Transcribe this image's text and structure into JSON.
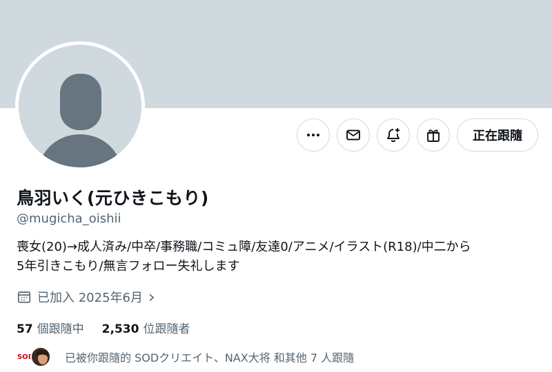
{
  "profile": {
    "display_name": "鳥羽いく(元ひきこもり)",
    "handle": "@mugicha_oishii",
    "bio_line1": "喪女(20)→成人済み/中卒/事務職/コミュ障/友達0/アニメ/イラスト(R18)/中二から",
    "bio_line2": "5年引きこもり/無言フォロー失礼します",
    "joined": "已加入 2025年6月",
    "joined_chevron": "›"
  },
  "actions": {
    "more_icon": "more-icon",
    "message_icon": "mail-icon",
    "notify_icon": "bell-plus-icon",
    "gift_icon": "gift-icon",
    "follow_label": "正在跟隨"
  },
  "stats": {
    "following_count": "57",
    "following_label": "個跟隨中",
    "followers_count": "2,530",
    "followers_label": "位跟隨者"
  },
  "followed_by": {
    "avatar1_text": "SOD",
    "text": "已被你跟隨的 SODクリエイト、NAX大将 和其他 7 人跟隨"
  },
  "colors": {
    "banner": "#cfd9de",
    "secondary_text": "#536471",
    "primary_text": "#0f1419",
    "border": "#cfd9de"
  }
}
